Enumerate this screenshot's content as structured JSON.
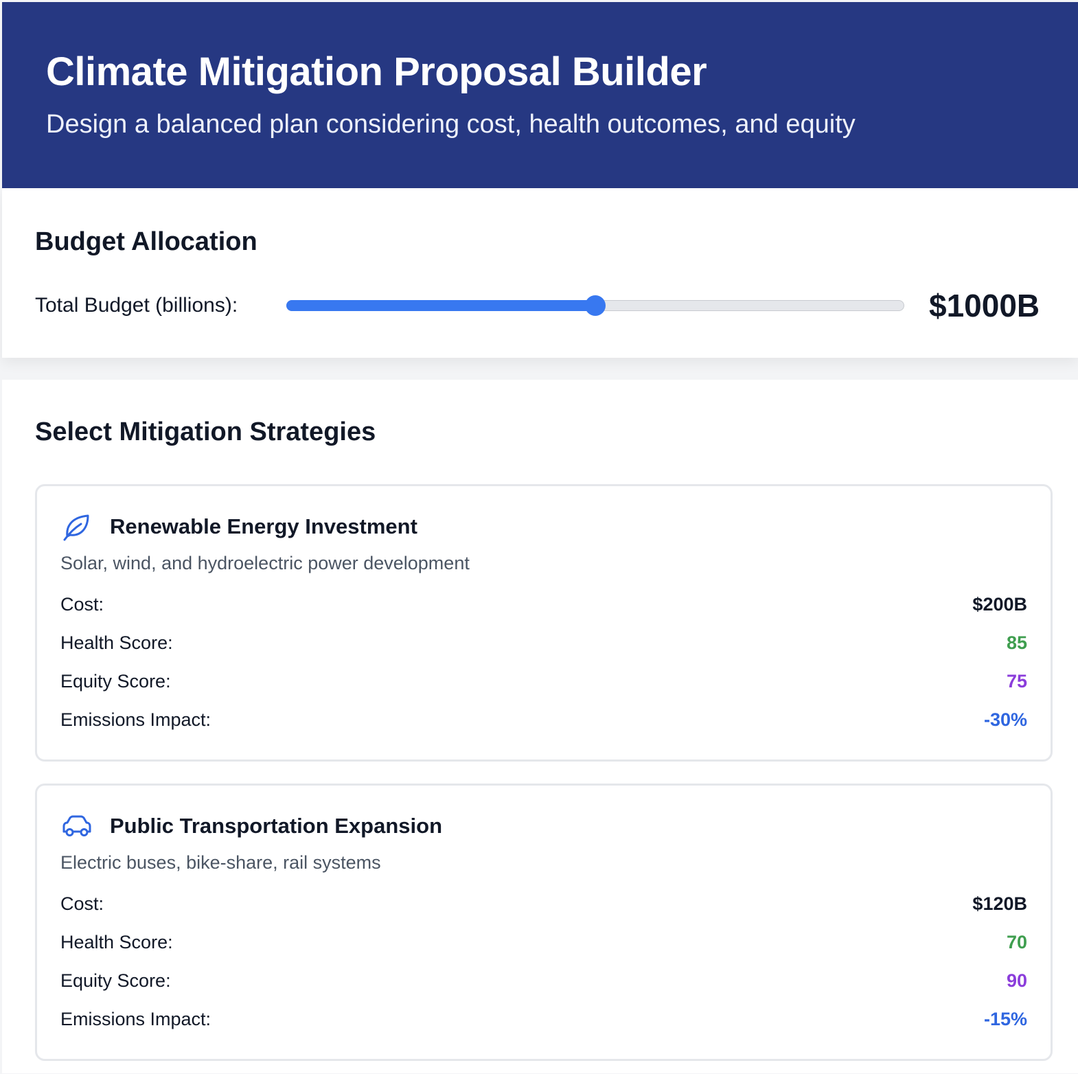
{
  "header": {
    "title": "Climate Mitigation Proposal Builder",
    "subtitle": "Design a balanced plan considering cost, health outcomes, and equity"
  },
  "budget": {
    "section_title": "Budget Allocation",
    "label": "Total Budget (billions):",
    "value_display": "$1000B",
    "slider_fraction": 0.5
  },
  "strategies": {
    "section_title": "Select Mitigation Strategies",
    "labels": {
      "cost": "Cost:",
      "health": "Health Score:",
      "equity": "Equity Score:",
      "emissions": "Emissions Impact:"
    },
    "colors": {
      "cost": "#111827",
      "health": "#3f9e4f",
      "equity": "#8b3ddb",
      "emissions": "#2f66e0",
      "icon": "#2f66e0"
    },
    "items": [
      {
        "icon": "leaf-icon",
        "title": "Renewable Energy Investment",
        "description": "Solar, wind, and hydroelectric power development",
        "cost": "$200B",
        "health": "85",
        "equity": "75",
        "emissions": "-30%"
      },
      {
        "icon": "car-icon",
        "title": "Public Transportation Expansion",
        "description": "Electric buses, bike-share, rail systems",
        "cost": "$120B",
        "health": "70",
        "equity": "90",
        "emissions": "-15%"
      }
    ]
  }
}
